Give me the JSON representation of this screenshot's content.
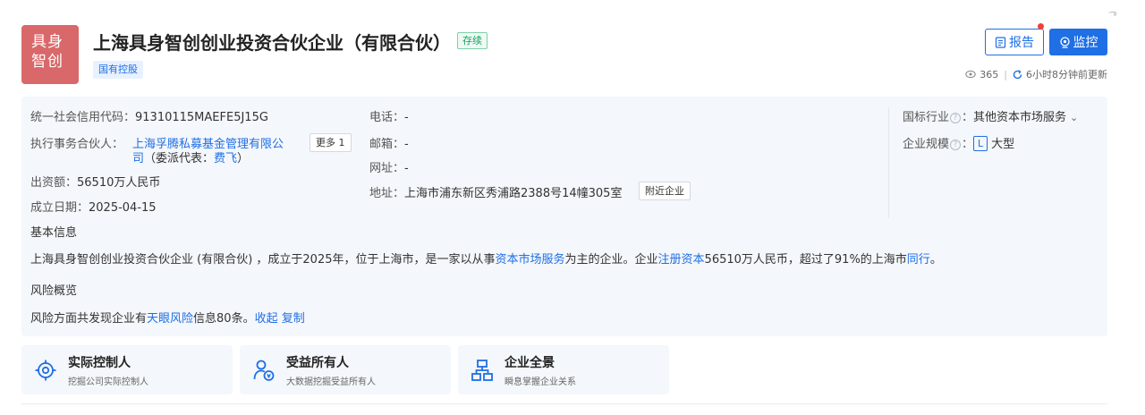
{
  "header": {
    "logo_line1": "具身",
    "logo_line2": "智创",
    "company_name": "上海具身智创创业投资合伙企业（有限合伙）",
    "status": "存续",
    "tag": "国有控股",
    "report_label": "报告",
    "monitor_label": "监控",
    "views": "365",
    "updated": "6小时8分钟前更新",
    "corner_mark": "͡°"
  },
  "info": {
    "credit_code_label": "统一社会信用代码：",
    "credit_code": "91310115MAEFE5J15G",
    "partner_label": "执行事务合伙人：",
    "partner_name_line1": "上海孚腾私募基金管理有限公",
    "partner_name_line2": "司",
    "delegate_prefix": "（委派代表：",
    "delegate_name": "费飞",
    "delegate_suffix": "）",
    "more_label": "更多 1",
    "capital_label": "出资额：",
    "capital": "56510万人民币",
    "founded_label": "成立日期：",
    "founded": "2025-04-15",
    "phone_label": "电话：",
    "phone": "-",
    "email_label": "邮箱：",
    "email": "-",
    "website_label": "网址：",
    "website": "-",
    "address_label": "地址：",
    "address": "上海市浦东新区秀浦路2388号14幢305室",
    "nearby_label": "附近企业",
    "industry_label": "国标行业",
    "industry": "其他资本市场服务",
    "scale_label": "企业规模",
    "scale_tag": "L",
    "scale": "大型",
    "colon": "："
  },
  "basic": {
    "title": "基本信息",
    "p1": "上海具身智创创业投资合伙企业 (有限合伙) ，成立于2025年，位于上海市，是一家以从事",
    "link1": "资本市场服务",
    "p2": "为主的企业。企业",
    "link2": "注册资本",
    "p3": "56510万人民币，超过了91%的上海市",
    "link3": "同行",
    "p4": "。"
  },
  "risk": {
    "title": "风险概览",
    "p1": "风险方面共发现企业有",
    "link1": "天眼风险",
    "p2": "信息80条。",
    "collapse": "收起",
    "copy": "复制"
  },
  "cards": [
    {
      "title": "实际控制人",
      "sub": "挖掘公司实际控制人",
      "icon": "target-icon"
    },
    {
      "title": "受益所有人",
      "sub": "大数据挖掘受益所有人",
      "icon": "beneficiary-icon"
    },
    {
      "title": "企业全景",
      "sub": "瞬息掌握企业关系",
      "icon": "org-chart-icon"
    }
  ],
  "colors": {
    "accent": "#1f6fe5",
    "logo_bg": "#d9686a",
    "status_green": "#19a15f",
    "panel_bg": "#f4f7fb"
  }
}
